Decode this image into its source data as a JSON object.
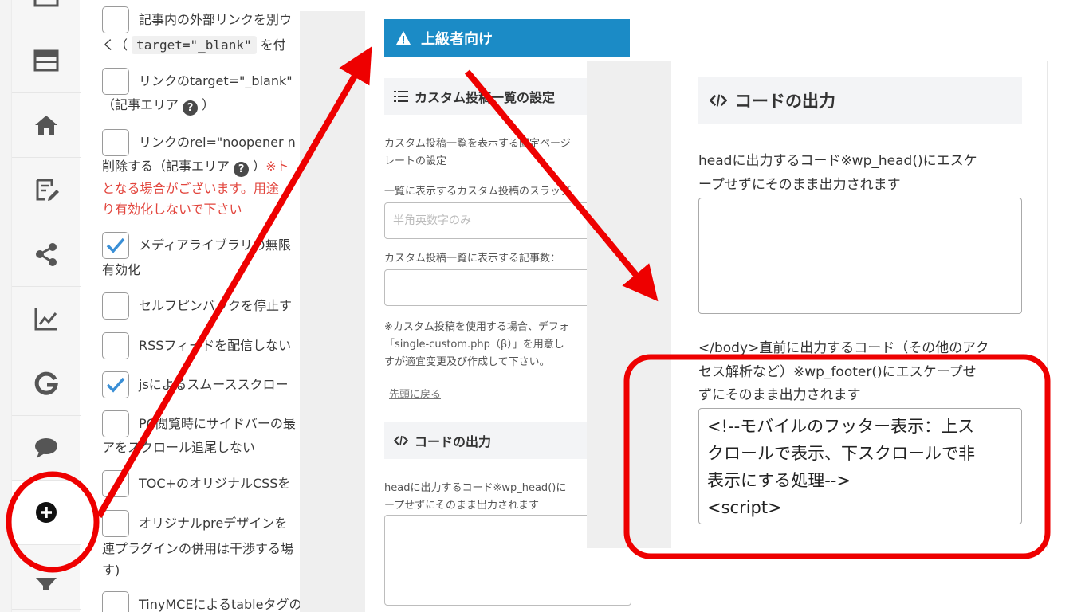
{
  "sidebar": {
    "icons": [
      "theme-layout-icon",
      "layout-icon",
      "home-icon",
      "edit-post-icon",
      "share-icon",
      "analytics-icon",
      "google-icon",
      "comment-icon",
      "plus-circle-icon",
      "filter-icon"
    ],
    "active": "plus-circle-icon"
  },
  "options": [
    {
      "checked": false,
      "lines": [
        "記事内の外部リンクを別ウ",
        "く（ target=\"_blank\" を付"
      ]
    },
    {
      "checked": false,
      "lines": [
        "リンクのtarget=\"_blank\"",
        "（記事エリア ? ）"
      ]
    },
    {
      "checked": false,
      "lines": [
        "リンクのrel=\"noopener n",
        "削除する（記事エリア ? ）※ト",
        "となる場合がございます。用途",
        "り有効化しないで下さい"
      ]
    },
    {
      "checked": true,
      "lines": [
        "メディアライブラリの無限",
        "有効化"
      ]
    },
    {
      "checked": false,
      "lines": [
        "セルフピンバックを停止す"
      ]
    },
    {
      "checked": false,
      "lines": [
        "RSSフィードを配信しない"
      ]
    },
    {
      "checked": true,
      "lines": [
        "jsによるスムーススクロー"
      ]
    },
    {
      "checked": false,
      "lines": [
        "PC閲覧時にサイドバーの最",
        "アをスクロール追尾しない"
      ]
    },
    {
      "checked": false,
      "lines": [
        "TOC+のオリジナルCSSを"
      ]
    },
    {
      "checked": false,
      "lines": [
        "オリジナルpreデザインを",
        "連プラグインの併用は干渉する場",
        "す)"
      ]
    },
    {
      "checked": false,
      "lines": [
        "TinyMCEによるtableタグのwidth放(ト"
      ]
    }
  ],
  "middle": {
    "banner": "上級者向け",
    "section1_title": "カスタム投稿一覧の設定",
    "desc1": [
      "カスタム投稿一覧を表示する固定ページ",
      "レートの設定"
    ],
    "label2": "一覧に表示するカスタム投稿のスラッグ",
    "input_placeholder": "半角英数字のみ",
    "label3": "カスタム投稿一覧に表示する記事数：",
    "note": [
      "※カスタム投稿を使用する場合、デフォ",
      "「single-custom.php（β）」を用意し",
      "すが適宜変更及び作成して下さい。"
    ],
    "back_link": "先頭に戻る",
    "section2_title": "コードの出力",
    "head_label": [
      "headに出力するコード※wp_head()に",
      "ープせずにそのまま出力されます"
    ]
  },
  "right": {
    "title": "コードの出力",
    "head_label": [
      "headに出力するコード※wp_head()にエスケ",
      "ープせずにそのまま出力されます"
    ],
    "footer_label": [
      "</body>直前に出力するコード（その他のアク",
      "セス解析など）※wp_footer()にエスケープせ",
      "ずにそのまま出力されます"
    ],
    "footer_code": [
      "<!--モバイルのフッター表示：上ス",
      "クロールで表示、下スクロールで非",
      "表示にする処理-->",
      "<script>"
    ]
  },
  "colors": {
    "annotation_red": "#ee0000",
    "banner_blue": "#1b8bc6",
    "check_blue": "#3a8fd6",
    "warning_text_red": "#e2453d"
  }
}
